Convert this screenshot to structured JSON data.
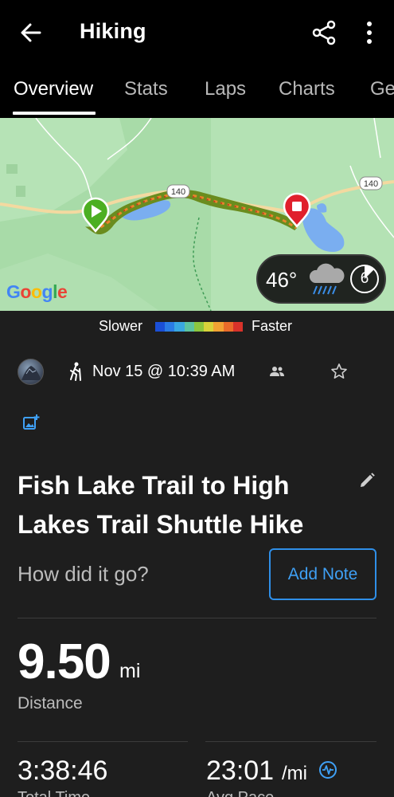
{
  "appbar": {
    "title": "Hiking",
    "back_icon": "arrow-left-icon",
    "share_icon": "share-icon",
    "more_icon": "more-vertical-icon"
  },
  "tabs": [
    {
      "label": "Overview",
      "active": true
    },
    {
      "label": "Stats",
      "active": false
    },
    {
      "label": "Laps",
      "active": false
    },
    {
      "label": "Charts",
      "active": false
    },
    {
      "label": "Ge",
      "active": false
    }
  ],
  "map": {
    "road_labels": [
      "140",
      "140"
    ],
    "google_logo": "Google",
    "weather": {
      "temperature": "46°",
      "condition_icon": "rain-cloud-icon",
      "wind_speed": "6"
    }
  },
  "legend": {
    "slower": "Slower",
    "faster": "Faster",
    "colors": [
      "#1a4fd6",
      "#2a7be4",
      "#39a7e0",
      "#5cc3a0",
      "#8cc63e",
      "#d8d23a",
      "#f2a233",
      "#ea6b2a",
      "#d8322a"
    ]
  },
  "activity": {
    "type_icon": "hiker-icon",
    "datetime": "Nov 15 @ 10:39 AM",
    "title": "Fish Lake Trail to High Lakes Trail Shuttle Hike",
    "prompt": "How did it go?",
    "add_note_label": "Add Note"
  },
  "stats": {
    "distance_value": "9.50",
    "distance_unit": "mi",
    "distance_label": "Distance",
    "time_value": "3:38:46",
    "time_label": "Total Time",
    "pace_value": "23:01",
    "pace_unit": "/mi",
    "pace_label": "Avg Pace"
  },
  "colors": {
    "accent_blue": "#2f8fe8",
    "map_green": "#a8dba8",
    "water": "#7aaef0",
    "start_marker": "#4caf22",
    "end_marker": "#e0202c"
  }
}
